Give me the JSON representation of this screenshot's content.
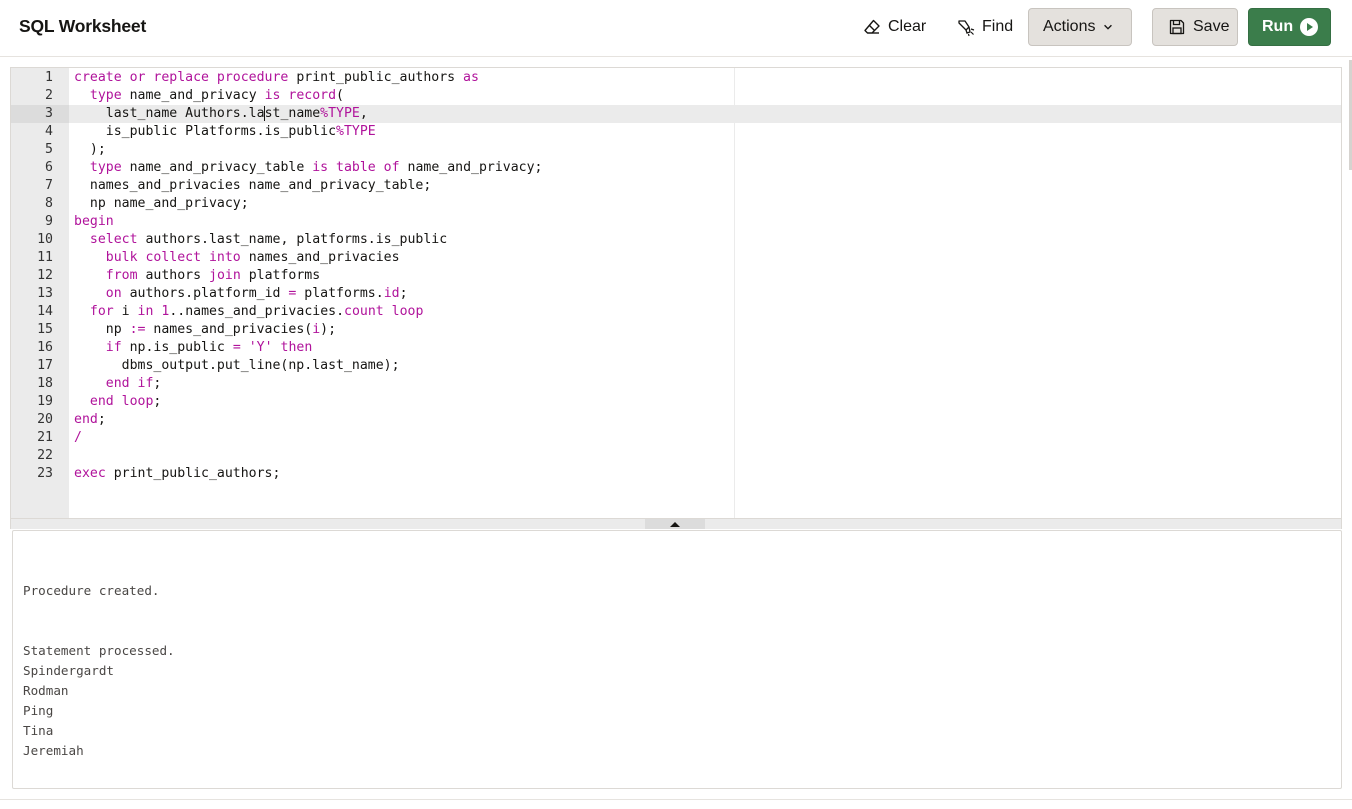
{
  "header": {
    "title": "SQL Worksheet",
    "clear_label": "Clear",
    "find_label": "Find",
    "actions_label": "Actions",
    "save_label": "Save",
    "run_label": "Run"
  },
  "editor": {
    "active_line": 3,
    "lines": [
      [
        {
          "t": "create or replace procedure",
          "k": 1
        },
        {
          "t": " print_public_authors "
        },
        {
          "t": "as",
          "k": 1
        }
      ],
      [
        {
          "t": "  "
        },
        {
          "t": "type",
          "k": 1
        },
        {
          "t": " name_and_privacy "
        },
        {
          "t": "is record",
          "k": 1
        },
        {
          "t": "("
        }
      ],
      [
        {
          "t": "    last_name Authors.la"
        },
        {
          "t": "st_name"
        },
        {
          "t": "%TYPE",
          "k": 1
        },
        {
          "t": ","
        }
      ],
      [
        {
          "t": "    is_public Platforms.is_public"
        },
        {
          "t": "%TYPE",
          "k": 1
        }
      ],
      [
        {
          "t": "  );"
        }
      ],
      [
        {
          "t": "  "
        },
        {
          "t": "type",
          "k": 1
        },
        {
          "t": " name_and_privacy_table "
        },
        {
          "t": "is table of",
          "k": 1
        },
        {
          "t": " name_and_privacy;"
        }
      ],
      [
        {
          "t": "  names_and_privacies name_and_privacy_table;"
        }
      ],
      [
        {
          "t": "  np name_and_privacy;"
        }
      ],
      [
        {
          "t": "begin",
          "k": 1
        }
      ],
      [
        {
          "t": "  "
        },
        {
          "t": "select",
          "k": 1
        },
        {
          "t": " authors.last_name, platforms.is_public"
        }
      ],
      [
        {
          "t": "    "
        },
        {
          "t": "bulk collect into",
          "k": 1
        },
        {
          "t": " names_and_privacies"
        }
      ],
      [
        {
          "t": "    "
        },
        {
          "t": "from",
          "k": 1
        },
        {
          "t": " authors "
        },
        {
          "t": "join",
          "k": 1
        },
        {
          "t": " platforms"
        }
      ],
      [
        {
          "t": "    "
        },
        {
          "t": "on",
          "k": 1
        },
        {
          "t": " authors.platform_id "
        },
        {
          "t": "=",
          "k": 1
        },
        {
          "t": " platforms."
        },
        {
          "t": "id",
          "k": 1
        },
        {
          "t": ";"
        }
      ],
      [
        {
          "t": "  "
        },
        {
          "t": "for",
          "k": 1
        },
        {
          "t": " i "
        },
        {
          "t": "in",
          "k": 1
        },
        {
          "t": " "
        },
        {
          "t": "1",
          "k": 1
        },
        {
          "t": "..names_and_privacies."
        },
        {
          "t": "count",
          "k": 1
        },
        {
          "t": " "
        },
        {
          "t": "loop",
          "k": 1
        }
      ],
      [
        {
          "t": "    np "
        },
        {
          "t": ":=",
          "k": 1
        },
        {
          "t": " names_and_privacies("
        },
        {
          "t": "i",
          "k": 1
        },
        {
          "t": ");"
        }
      ],
      [
        {
          "t": "    "
        },
        {
          "t": "if",
          "k": 1
        },
        {
          "t": " np.is_public "
        },
        {
          "t": "=",
          "k": 1
        },
        {
          "t": " "
        },
        {
          "t": "'Y'",
          "k": 1
        },
        {
          "t": " "
        },
        {
          "t": "then",
          "k": 1
        }
      ],
      [
        {
          "t": "      dbms_output.put_line(np.last_name);"
        }
      ],
      [
        {
          "t": "    "
        },
        {
          "t": "end if",
          "k": 1
        },
        {
          "t": ";"
        }
      ],
      [
        {
          "t": "  "
        },
        {
          "t": "end loop",
          "k": 1
        },
        {
          "t": ";"
        }
      ],
      [
        {
          "t": "end",
          "k": 1
        },
        {
          "t": ";"
        }
      ],
      [
        {
          "t": "/",
          "k": 1
        }
      ],
      [],
      [
        {
          "t": "exec",
          "k": 1
        },
        {
          "t": " print_public_authors;"
        }
      ]
    ]
  },
  "output": {
    "lines": [
      "",
      "Procedure created.",
      "",
      "",
      "Statement processed.",
      "Spindergardt",
      "Rodman",
      "Ping",
      "Tina",
      "Jeremiah"
    ]
  },
  "colors": {
    "keyword": "#b0139b",
    "run_button": "#3b7d4b",
    "gutter": "#ebebeb"
  },
  "icons": {
    "clear": "eraser-icon",
    "find": "search-highlighter-icon",
    "actions": "chevron-down-icon",
    "save": "floppy-disk-icon",
    "run": "play-circle-icon"
  }
}
